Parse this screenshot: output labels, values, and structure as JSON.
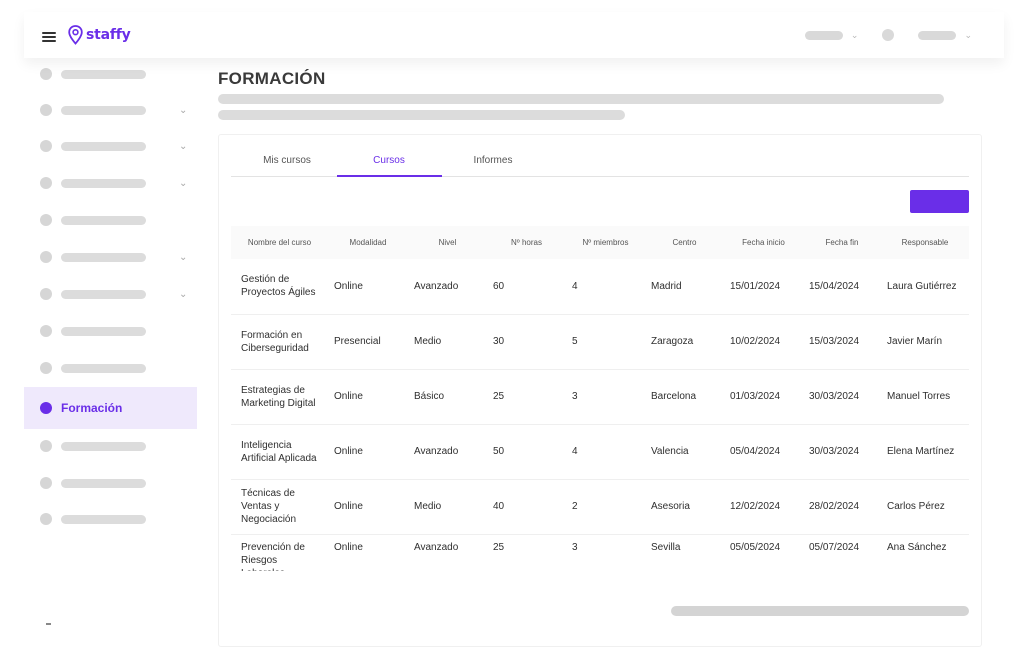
{
  "app": {
    "logo_text": "staffy",
    "brand_color": "#6a2ee8"
  },
  "sidebar": {
    "active_label": "Formación"
  },
  "page": {
    "title": "FORMACIÓN"
  },
  "tabs": [
    {
      "label": "Mis cursos",
      "active": false
    },
    {
      "label": "Cursos",
      "active": true
    },
    {
      "label": "Informes",
      "active": false
    }
  ],
  "table": {
    "headers": [
      "Nombre del curso",
      "Modalidad",
      "Nivel",
      "Nº horas",
      "Nº miembros",
      "Centro",
      "Fecha inicio",
      "Fecha fin",
      "Responsable"
    ],
    "rows": [
      [
        "Gestión de Proyectos Ágiles",
        "Online",
        "Avanzado",
        "60",
        "4",
        "Madrid",
        "15/01/2024",
        "15/04/2024",
        "Laura Gutiérrez"
      ],
      [
        "Formación en Ciberseguridad",
        "Presencial",
        "Medio",
        "30",
        "5",
        "Zaragoza",
        "10/02/2024",
        "15/03/2024",
        "Javier Marín"
      ],
      [
        "Estrategias de Marketing Digital",
        "Online",
        "Básico",
        "25",
        "3",
        "Barcelona",
        "01/03/2024",
        "30/03/2024",
        "Manuel Torres"
      ],
      [
        "Inteligencia Artificial Aplicada",
        "Online",
        "Avanzado",
        "50",
        "4",
        "Valencia",
        "05/04/2024",
        "30/03/2024",
        "Elena Martínez"
      ],
      [
        "Técnicas de Ventas y Negociación",
        "Online",
        "Medio",
        "40",
        "2",
        "Asesoria",
        "12/02/2024",
        "28/02/2024",
        "Carlos Pérez"
      ],
      [
        "Prevención de Riesgos Laborales",
        "Online",
        "Avanzado",
        "25",
        "3",
        "Sevilla",
        "05/05/2024",
        "05/07/2024",
        "Ana Sánchez"
      ]
    ]
  }
}
